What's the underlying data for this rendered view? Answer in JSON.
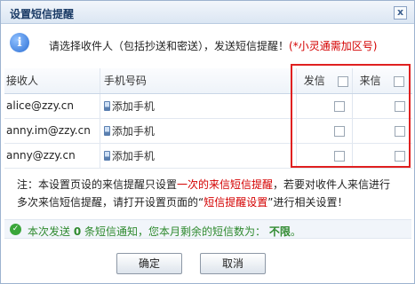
{
  "dialog": {
    "title": "设置短信提醒",
    "close_label": "x"
  },
  "info": {
    "icon_name": "info-icon",
    "text": "请选择收件人（包括抄送和密送），发送短信提醒！",
    "red_note": "(*小灵通需加区号)"
  },
  "table": {
    "headers": {
      "recipient": "接收人",
      "phone": "手机号码",
      "send": "发信",
      "receive": "来信"
    },
    "rows": [
      {
        "recipient": "alice@zzy.cn",
        "phone": "添加手机"
      },
      {
        "recipient": "anny.im@zzy.cn",
        "phone": "添加手机"
      },
      {
        "recipient": "anny@zzy.cn",
        "phone": "添加手机"
      }
    ]
  },
  "note": {
    "part1": "注：本设置页设的来信提醒只设置",
    "red1": "一次的来信短信提醒",
    "part2": "，若要对收件人来信进行多次来信短信提醒，请打开设置页面的“",
    "red2": "短信提醒设置",
    "part3": "”进行相关设置！"
  },
  "status": {
    "prefix": "本次发送",
    "count": "0",
    "middle": "条短信通知，您本月剩余的短信数为：",
    "remaining": "不限",
    "suffix": "。"
  },
  "buttons": {
    "ok": "确定",
    "cancel": "取消"
  },
  "colors": {
    "highlight_frame": "#e02020",
    "red_text": "#d40000",
    "status_green": "#2f8a2f"
  }
}
